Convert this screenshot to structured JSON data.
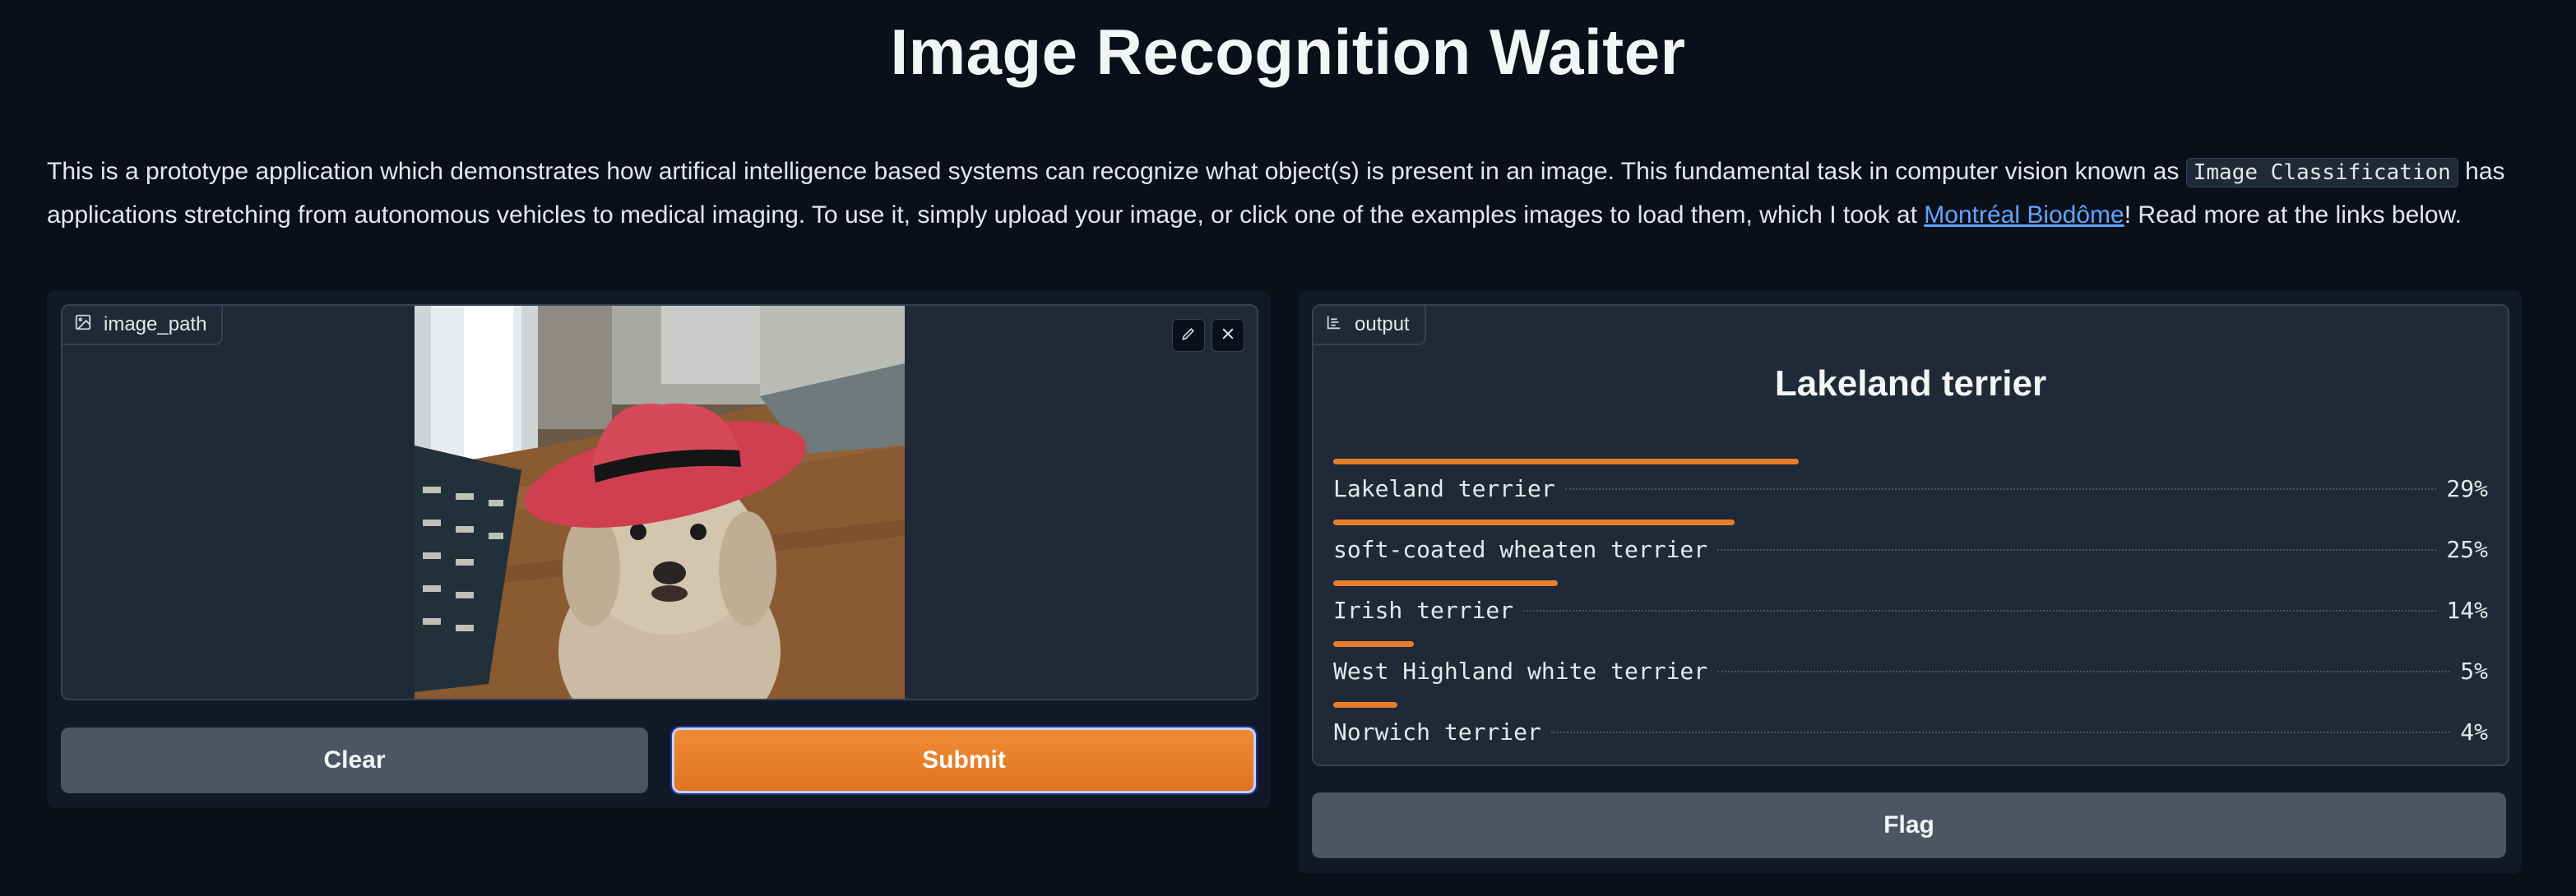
{
  "header": {
    "title": "Image Recognition Waiter"
  },
  "description": {
    "text_before_code": "This is a prototype application which demonstrates how artifical intelligence based systems can recognize what object(s) is present in an image. This fundamental task in computer vision known as ",
    "code": "Image Classification",
    "text_after_code": " has applications stretching from autonomous vehicles to medical imaging. To use it, simply upload your image, or click one of the examples images to load them, which I took at ",
    "link": "Montréal Biodôme",
    "text_end": "! Read more at the links below."
  },
  "input_panel": {
    "label": "image_path",
    "label_icon": "image-icon",
    "edit_icon": "pencil-icon",
    "close_icon": "close-icon",
    "clear_label": "Clear",
    "submit_label": "Submit"
  },
  "output_panel": {
    "label": "output",
    "label_icon": "bar-chart-icon",
    "top_label": "Lakeland terrier",
    "confidences": [
      {
        "label": "Lakeland terrier",
        "percent": "29%",
        "value": 0.29
      },
      {
        "label": "soft-coated wheaten terrier",
        "percent": "25%",
        "value": 0.25
      },
      {
        "label": "Irish terrier",
        "percent": "14%",
        "value": 0.14
      },
      {
        "label": "West Highland white terrier",
        "percent": "5%",
        "value": 0.05
      },
      {
        "label": "Norwich terrier",
        "percent": "4%",
        "value": 0.04
      }
    ],
    "flag_label": "Flag"
  },
  "colors": {
    "background": "#0b0f19",
    "panel": "#111827",
    "block": "#1f2937",
    "accent": "#e87e2b",
    "link": "#60a5fa"
  }
}
